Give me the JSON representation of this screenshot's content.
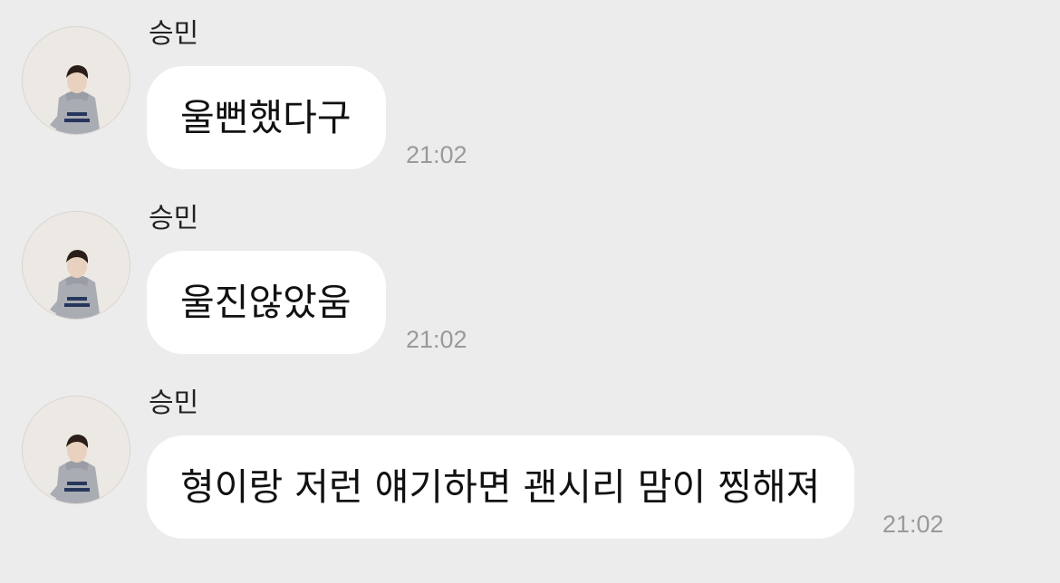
{
  "messages": [
    {
      "sender": "승민",
      "text": "울뻔했다구",
      "time": "21:02",
      "avatar": "profile-photo"
    },
    {
      "sender": "승민",
      "text": "울진않았움",
      "time": "21:02",
      "avatar": "profile-photo"
    },
    {
      "sender": "승민",
      "text": "형이랑 저런 얘기하면 괜시리 맘이 찡해져",
      "time": "21:02",
      "avatar": "profile-photo"
    }
  ]
}
